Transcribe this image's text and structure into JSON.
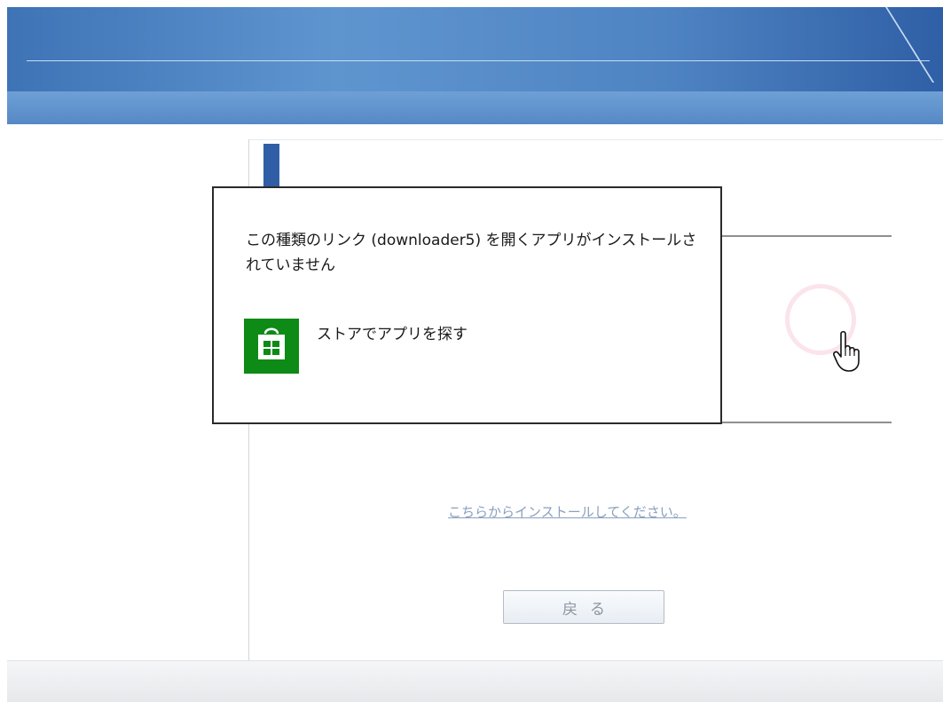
{
  "dialog": {
    "message": "この種類のリンク (downloader5) を開くアプリがインストールされていません",
    "store_option_label": "ストアでアプリを探す",
    "store_icon": "windows-store-icon"
  },
  "page": {
    "install_link": "こちらからインストールしてください。",
    "back_button": "戻る"
  },
  "icons": {
    "cursor": "hand-pointer-icon",
    "loading": "loading-spinner-icon"
  },
  "colors": {
    "header_blue": "#4f84c3",
    "store_green": "#0e8a16",
    "accent_blue": "#2f5ea6"
  }
}
